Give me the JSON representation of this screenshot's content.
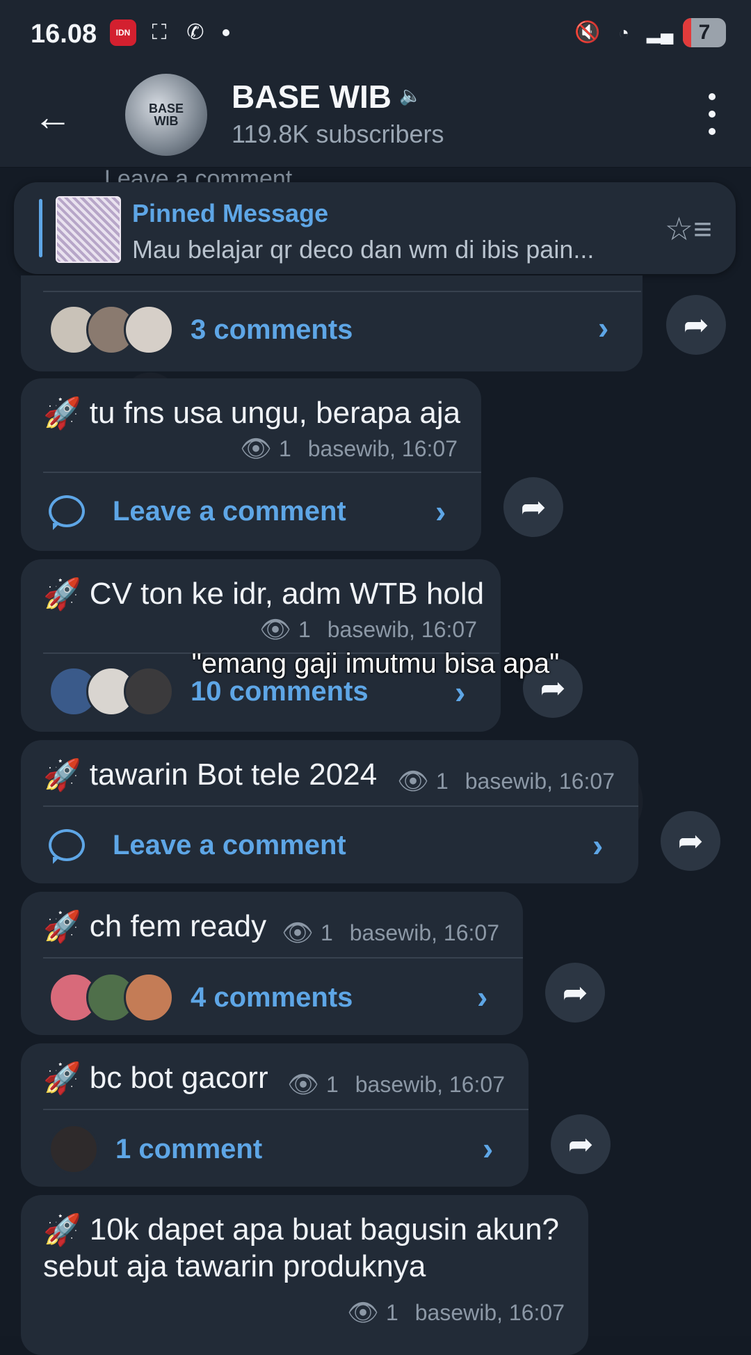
{
  "status_bar": {
    "time": "16.08",
    "idn_label": "IDN",
    "battery": "7"
  },
  "header": {
    "avatar_text": "BASE WIB",
    "title": "BASE WIB",
    "subtitle": "119.8K subscribers"
  },
  "top_partial": "Leave a comment",
  "pinned": {
    "title": "Pinned Message",
    "text": "Mau belajar qr deco dan wm di ibis pain..."
  },
  "first_block": {
    "comments_label": "3 comments"
  },
  "messages": [
    {
      "text": "tu fns usa ungu, berapa aja",
      "views": "1",
      "meta": "basewib, 16:07",
      "comment_label": "Leave a comment"
    },
    {
      "text": "CV ton ke idr, adm WTB hold",
      "views": "1",
      "meta": "basewib, 16:07",
      "comment_label": "10 comments"
    },
    {
      "text": "tawarin Bot tele 2024",
      "views": "1",
      "meta": "basewib, 16:07",
      "comment_label": "Leave a comment"
    },
    {
      "text": "ch fem ready",
      "views": "1",
      "meta": "basewib, 16:07",
      "comment_label": "4 comments"
    },
    {
      "text": "bc bot gacorr",
      "views": "1",
      "meta": "basewib, 16:07",
      "comment_label": "1 comment"
    },
    {
      "text": "10k dapet apa buat bagusin akun?",
      "text2": "sebut aja tawarin produknya",
      "views": "1",
      "meta": "basewib, 16:07"
    }
  ],
  "overlay_caption": "\"emang gaji imutmu bisa apa\"",
  "colors": {
    "accent": "#5ea6e6",
    "bubble": "#222b37",
    "background": "#141b25"
  }
}
